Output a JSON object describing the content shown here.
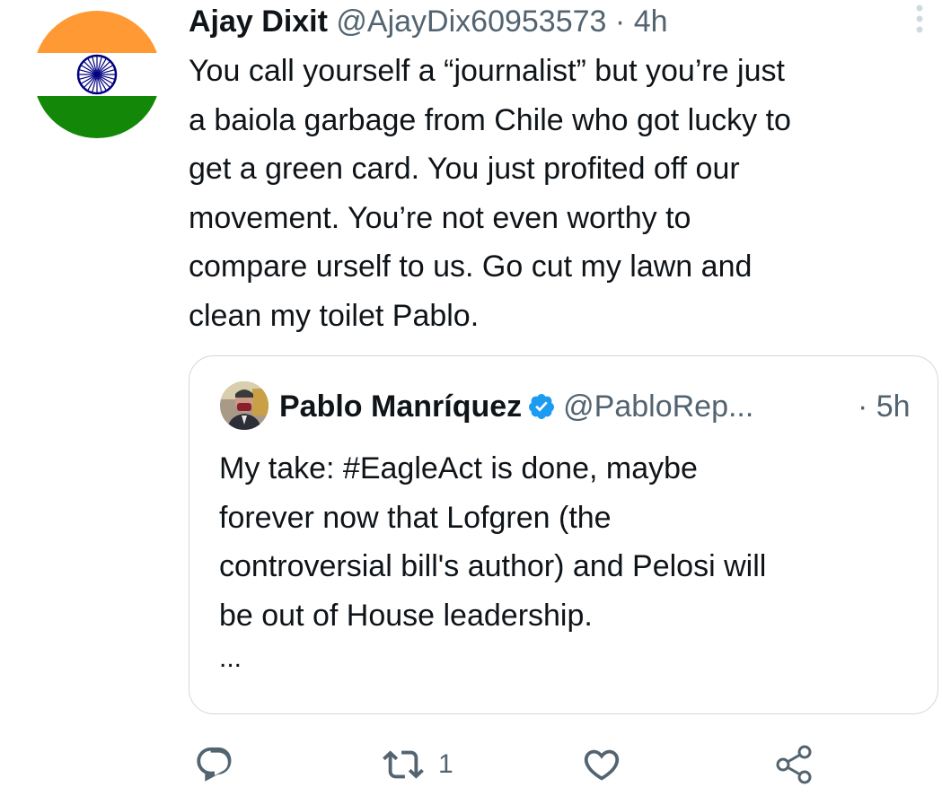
{
  "tweet": {
    "author_name": "Ajay Dixit",
    "author_handle": "@AjayDix60953573",
    "separator": "·",
    "time": "4h",
    "text_lines": [
      "You call yourself a “journalist” but you’re just",
      "a baiola garbage from Chile who got lucky to",
      "get a green card. You just profited off our",
      "movement. You’re not even worthy to",
      "compare urself to us. Go cut my lawn and",
      "clean my toilet Pablo."
    ]
  },
  "quote": {
    "author_name": "Pablo Manríquez",
    "author_handle": "@PabloRep...",
    "time": "· 5h",
    "text_lines": [
      "My take: #EagleAct is done, maybe",
      "forever now that Lofgren (the",
      "controversial bill's author) and Pelosi will",
      "be out of House leadership."
    ],
    "ellipsis": "..."
  },
  "actions": {
    "reply_icon": "reply-icon",
    "retweet_icon": "retweet-icon",
    "retweet_count": "1",
    "like_icon": "heart-icon",
    "share_icon": "share-icon"
  },
  "colors": {
    "text": "#0f1419",
    "secondary": "#536471",
    "border": "#cfd9de",
    "verified": "#1d9bf0",
    "saffron": "#ff9933",
    "india_green": "#138808",
    "chakra_blue": "#000080"
  }
}
